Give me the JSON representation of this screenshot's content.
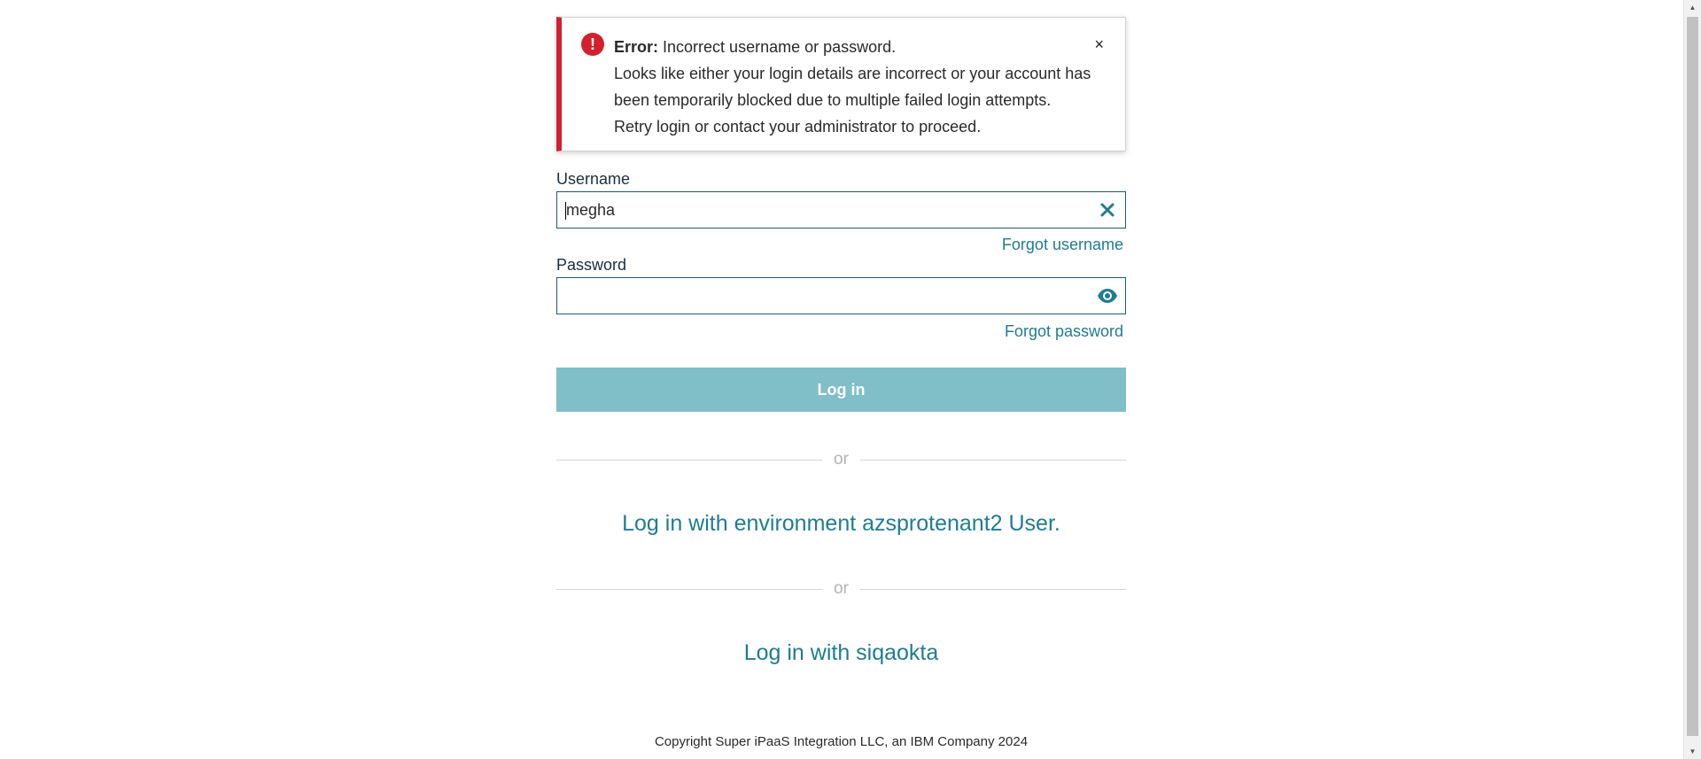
{
  "alert": {
    "label": "Error:",
    "title": "Incorrect username or password.",
    "line1": "Looks like either your login details are incorrect or your account has",
    "line2": "been temporarily blocked due to multiple failed login attempts.",
    "line3": "Retry login or contact your administrator to proceed.",
    "icon": "exclamation-icon",
    "close_glyph": "×",
    "color": "#d3202f"
  },
  "form": {
    "username_label": "Username",
    "username_value": "megha",
    "forgot_username": "Forgot username",
    "password_label": "Password",
    "password_value": "",
    "forgot_password": "Forgot password",
    "login_button": "Log in"
  },
  "alternatives": {
    "or_text": "or",
    "environment_login": "Log in with environment azsprotenant2 User.",
    "sso_login": "Log in with siqaokta"
  },
  "footer": {
    "copyright": "Copyright Super iPaaS Integration LLC, an IBM Company 2024"
  },
  "colors": {
    "accent": "#1f7c93",
    "button_bg": "#80bec8",
    "error": "#d3202f"
  }
}
